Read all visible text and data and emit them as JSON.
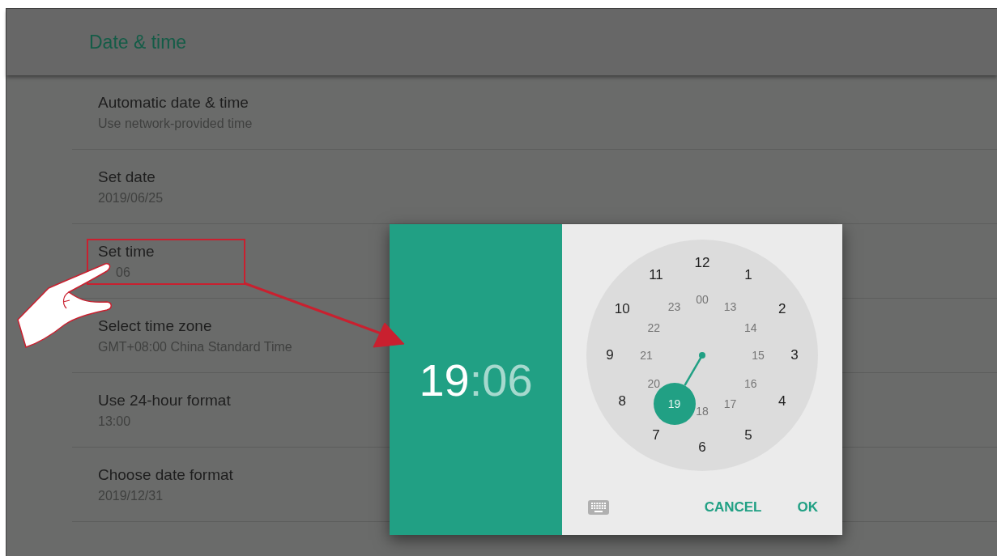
{
  "header": {
    "title": "Date & time"
  },
  "settings": [
    {
      "title": "Automatic date & time",
      "subtitle": "Use network-provided time"
    },
    {
      "title": "Set date",
      "subtitle": "2019/06/25"
    },
    {
      "title": "Set time",
      "subtitle": "06"
    },
    {
      "title": "Select time zone",
      "subtitle": "GMT+08:00 China Standard Time"
    },
    {
      "title": "Use 24-hour format",
      "subtitle": "13:00"
    },
    {
      "title": "Choose date format",
      "subtitle": "2019/12/31"
    }
  ],
  "time_picker": {
    "hour": {
      "text": "19",
      "selected": true
    },
    "separator": ":",
    "minute": {
      "text": "06",
      "selected": false
    },
    "outer_numbers": [
      {
        "text": "12",
        "selected": false
      },
      {
        "text": "1",
        "selected": false
      },
      {
        "text": "2",
        "selected": false
      },
      {
        "text": "3",
        "selected": false
      },
      {
        "text": "4",
        "selected": false
      },
      {
        "text": "5",
        "selected": false
      },
      {
        "text": "6",
        "selected": false
      },
      {
        "text": "7",
        "selected": false
      },
      {
        "text": "8",
        "selected": false
      },
      {
        "text": "9",
        "selected": false
      },
      {
        "text": "10",
        "selected": false
      },
      {
        "text": "11",
        "selected": false
      }
    ],
    "inner_numbers": [
      {
        "text": "00",
        "selected": false
      },
      {
        "text": "13",
        "selected": false
      },
      {
        "text": "14",
        "selected": false
      },
      {
        "text": "15",
        "selected": false
      },
      {
        "text": "16",
        "selected": false
      },
      {
        "text": "17",
        "selected": false
      },
      {
        "text": "18",
        "selected": false
      },
      {
        "text": "19",
        "selected": true
      },
      {
        "text": "20",
        "selected": false
      },
      {
        "text": "21",
        "selected": false
      },
      {
        "text": "22",
        "selected": false
      },
      {
        "text": "23",
        "selected": false
      }
    ],
    "buttons": [
      "CANCEL",
      "OK"
    ]
  }
}
